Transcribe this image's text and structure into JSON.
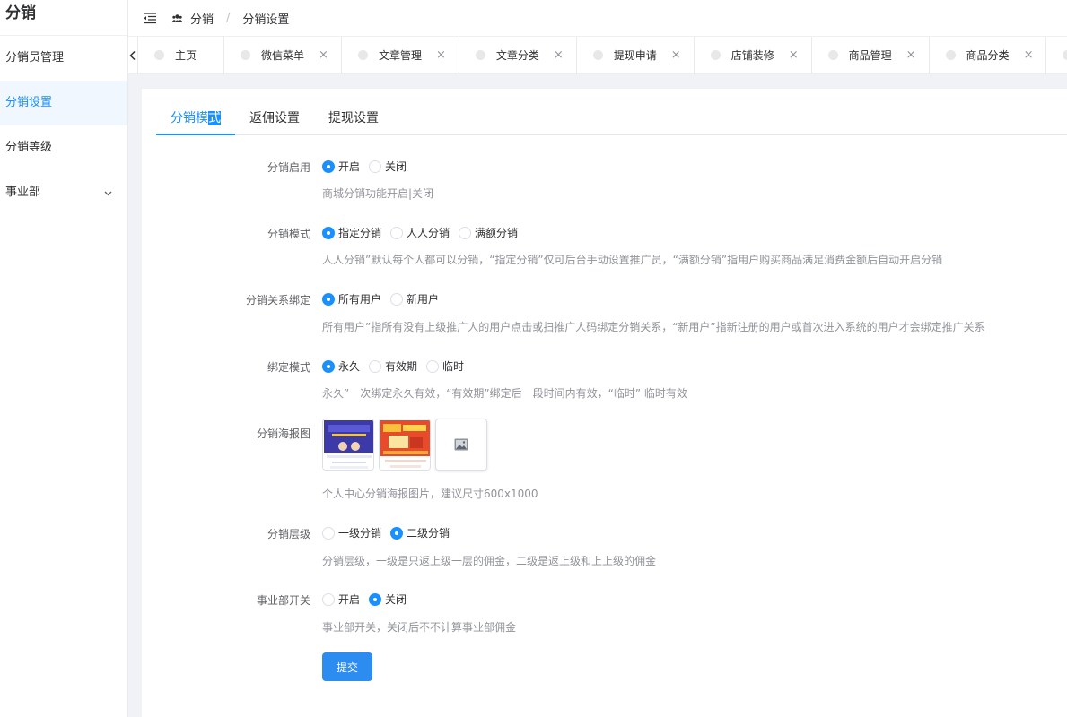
{
  "sidebar": {
    "title": "分销",
    "items": [
      {
        "label": "分销员管理"
      },
      {
        "label": "分销设置"
      },
      {
        "label": "分销等级"
      },
      {
        "label": "事业部"
      }
    ]
  },
  "header": {
    "breadcrumb_root": "分销",
    "breadcrumb_sep": "/",
    "breadcrumb_current": "分销设置"
  },
  "tabs": [
    {
      "label": "主页"
    },
    {
      "label": "微信菜单"
    },
    {
      "label": "文章管理"
    },
    {
      "label": "文章分类"
    },
    {
      "label": "提现申请"
    },
    {
      "label": "店铺装修"
    },
    {
      "label": "商品管理"
    },
    {
      "label": "商品分类"
    }
  ],
  "content_tabs": {
    "tab1_a": "分销模",
    "tab1_b": "式",
    "tab2": "返佣设置",
    "tab3": "提现设置"
  },
  "form": {
    "enable": {
      "label": "分销启用",
      "options": [
        "开启",
        "关闭"
      ],
      "selected": "开启",
      "tip": "商城分销功能开启|关闭"
    },
    "mode": {
      "label": "分销模式",
      "options": [
        "指定分销",
        "人人分销",
        "满额分销"
      ],
      "selected": "指定分销",
      "tip": "人人分销”默认每个人都可以分销，“指定分销”仅可后台手动设置推广员，“满额分销”指用户购买商品满足消费金额后自动开启分销"
    },
    "relation": {
      "label": "分销关系绑定",
      "options": [
        "所有用户",
        "新用户"
      ],
      "selected": "所有用户",
      "tip": "所有用户”指所有没有上级推广人的用户点击或扫推广人码绑定分销关系，“新用户”指新注册的用户或首次进入系统的用户才会绑定推广关系"
    },
    "bind_mode": {
      "label": "绑定模式",
      "options": [
        "永久",
        "有效期",
        "临时"
      ],
      "selected": "永久",
      "tip": "永久”一次绑定永久有效，“有效期”绑定后一段时间内有效，“临时” 临时有效"
    },
    "poster": {
      "label": "分销海报图",
      "tip": "个人中心分销海报图片，建议尺寸600x1000"
    },
    "level": {
      "label": "分销层级",
      "options": [
        "一级分销",
        "二级分销"
      ],
      "selected": "二级分销",
      "tip": "分销层级，一级是只返上级一层的佣金，二级是返上级和上上级的佣金"
    },
    "division": {
      "label": "事业部开关",
      "options": [
        "开启",
        "关闭"
      ],
      "selected": "关闭",
      "tip": "事业部开关，关闭后不不计算事业部佣金"
    },
    "submit_label": "提交"
  },
  "colors": {
    "accent": "#1890ff",
    "button": "#2d8cf0"
  }
}
